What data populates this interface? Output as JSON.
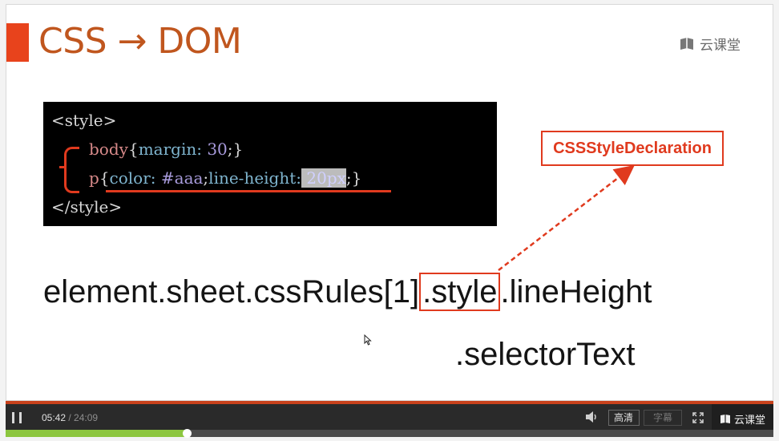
{
  "slide": {
    "title": "CSS → DOM",
    "brand": "云课堂",
    "code": {
      "open_tag": "<style>",
      "line1_sel": "body",
      "line1_open": "{",
      "line1_prop": "margin:",
      "line1_val": " 30",
      "line1_end": ";}",
      "line2_sel": "p",
      "line2_open": "{",
      "line2_prop1": "color:",
      "line2_val1": " #aaa",
      "line2_semi": ";",
      "line2_prop2": "line-height:",
      "line2_val2": " 20px",
      "line2_end": ";}",
      "close_tag": "</style>"
    },
    "declaration_label": "CSSStyleDeclaration",
    "expression_before": "element.sheet.cssRules[1]",
    "expression_style": ".style",
    "expression_after": ".lineHeight",
    "selector_text": ".selectorText"
  },
  "player": {
    "current_time": "05:42",
    "separator": " / ",
    "total_time": "24:09",
    "hd_label": "高清",
    "subtitle_label": "字幕",
    "brand": "云课堂",
    "progress_fraction": 0.236
  },
  "colors": {
    "accent": "#e03a1e",
    "title": "#c0561e",
    "progress": "#8cc63f"
  }
}
